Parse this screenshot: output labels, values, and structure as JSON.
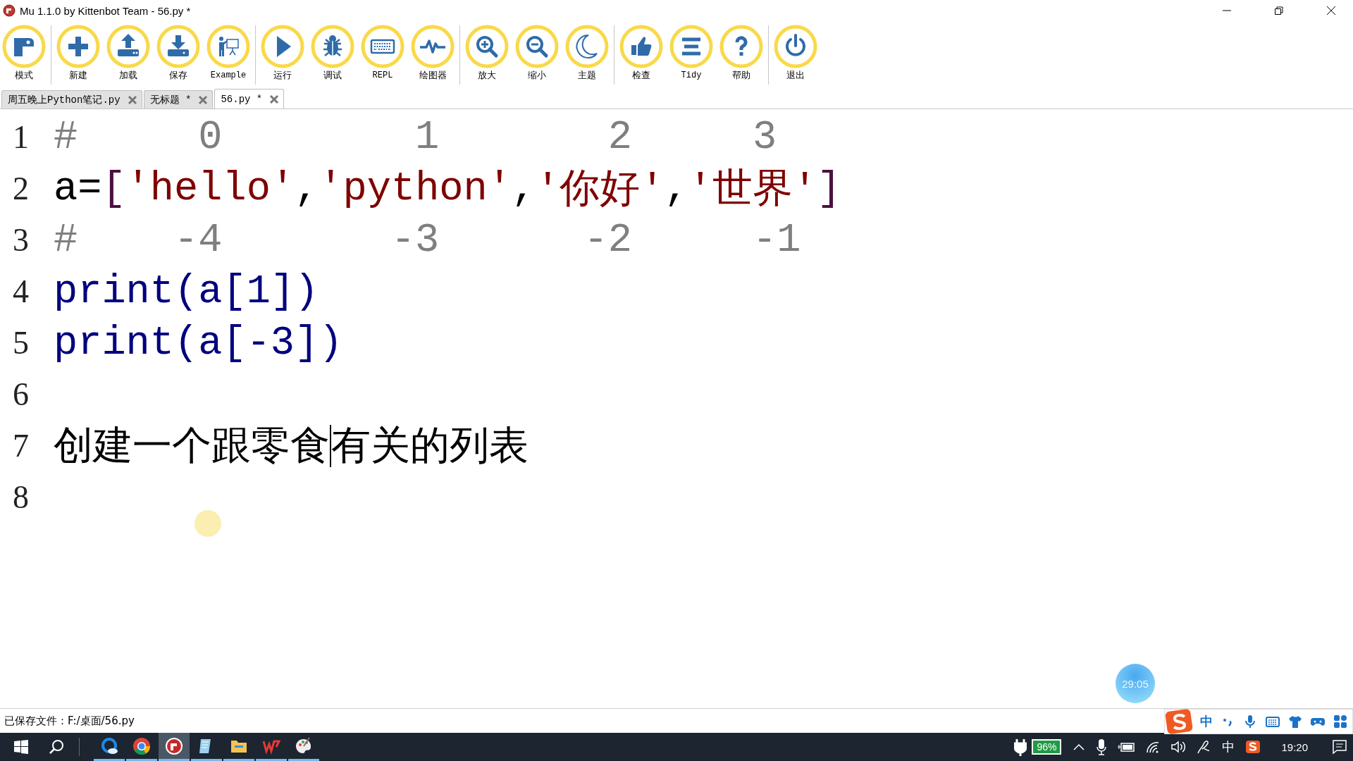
{
  "window": {
    "title": "Mu 1.1.0 by Kittenbot Team - 56.py *"
  },
  "toolbar": [
    [
      {
        "kind": "mode",
        "label": "模式"
      }
    ],
    [
      {
        "kind": "new",
        "label": "新建"
      },
      {
        "kind": "load",
        "label": "加载"
      },
      {
        "kind": "save",
        "label": "保存"
      },
      {
        "kind": "example",
        "label": "Example"
      }
    ],
    [
      {
        "kind": "run",
        "label": "运行"
      },
      {
        "kind": "debug",
        "label": "调试"
      },
      {
        "kind": "repl",
        "label": "REPL"
      },
      {
        "kind": "plotter",
        "label": "绘图器"
      }
    ],
    [
      {
        "kind": "zoom-in",
        "label": "放大"
      },
      {
        "kind": "zoom-out",
        "label": "缩小"
      },
      {
        "kind": "theme",
        "label": "主题"
      }
    ],
    [
      {
        "kind": "check",
        "label": "检查"
      },
      {
        "kind": "tidy",
        "label": "Tidy"
      },
      {
        "kind": "help",
        "label": "帮助"
      }
    ],
    [
      {
        "kind": "quit",
        "label": "退出"
      }
    ]
  ],
  "tabs": [
    {
      "label": "周五晚上Python笔记.py",
      "selected": false
    },
    {
      "label": "无标题 *",
      "selected": false
    },
    {
      "label": "56.py *",
      "selected": true
    }
  ],
  "editor": {
    "lines": [
      {
        "number": "1",
        "tokens": [
          {
            "kind": "comment",
            "text": "#     0        1       2     3"
          }
        ]
      },
      {
        "number": "2",
        "tokens": [
          {
            "kind": "name",
            "text": "a"
          },
          {
            "kind": "op",
            "text": "="
          },
          {
            "kind": "bracket",
            "text": "["
          },
          {
            "kind": "string",
            "text": "'hello'"
          },
          {
            "kind": "op",
            "text": ","
          },
          {
            "kind": "string",
            "text": "'python'"
          },
          {
            "kind": "op",
            "text": ","
          },
          {
            "kind": "string",
            "text": "'你好'"
          },
          {
            "kind": "op",
            "text": ","
          },
          {
            "kind": "string",
            "text": "'世界'"
          },
          {
            "kind": "bracket",
            "text": "]"
          }
        ]
      },
      {
        "number": "3",
        "tokens": [
          {
            "kind": "comment",
            "text": "#    -4       -3      -2     -1"
          }
        ]
      },
      {
        "number": "4",
        "tokens": [
          {
            "kind": "builtin",
            "text": "print"
          },
          {
            "kind": "paren",
            "text": "(a[1])"
          }
        ]
      },
      {
        "number": "5",
        "tokens": [
          {
            "kind": "builtin",
            "text": "print"
          },
          {
            "kind": "paren",
            "text": "(a[-3])"
          }
        ]
      },
      {
        "number": "6"
      },
      {
        "number": "7",
        "tokens": [
          {
            "kind": "text",
            "text": "创建一个跟零食",
            "caret_before": false
          },
          {
            "kind": "text",
            "text": "有关的列表",
            "caret_before": true
          }
        ]
      },
      {
        "number": "8"
      }
    ]
  },
  "timer": {
    "text": "29:05"
  },
  "status_bar": {
    "text": "已保存文件：F:/桌面/56.py"
  },
  "ime_bar": {
    "mode": "中"
  },
  "taskbar": {
    "apps": [
      {
        "kind": "browser-cloud",
        "selected": false
      },
      {
        "kind": "chrome",
        "selected": false
      },
      {
        "kind": "mu",
        "selected": true
      },
      {
        "kind": "notepad",
        "selected": false
      },
      {
        "kind": "folder",
        "selected": false
      },
      {
        "kind": "wps",
        "selected": false
      },
      {
        "kind": "paint",
        "selected": false
      }
    ],
    "battery": "96%",
    "input_mode": "中",
    "clock": "19:20"
  }
}
